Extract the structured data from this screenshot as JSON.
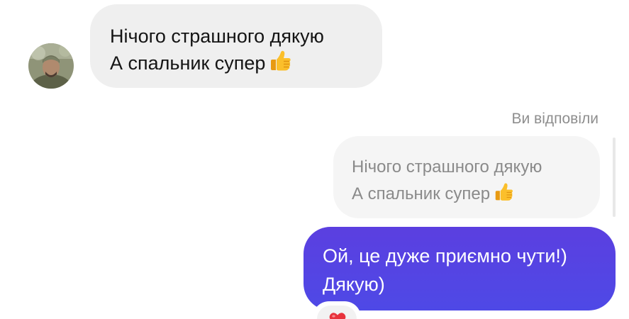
{
  "incoming_message": {
    "line1": "Нічого страшного дякую",
    "line2": "А спальник супер",
    "emoji": "thumbs-up-icon"
  },
  "reply_context": {
    "label": "Ви відповіли",
    "quoted_line1": "Нічого страшного дякую",
    "quoted_line2": "А спальник супер",
    "quoted_emoji": "thumbs-up-icon"
  },
  "outgoing_message": {
    "line1": "Ой, це дуже приємно чути!)",
    "line2": "Дякую)",
    "reaction": "red-heart-icon"
  },
  "colors": {
    "incoming_bubble": "#efefef",
    "outgoing_bubble": "#5b3fe0",
    "quoted_bubble": "#f5f5f5",
    "muted_text": "#8e8e8e"
  }
}
